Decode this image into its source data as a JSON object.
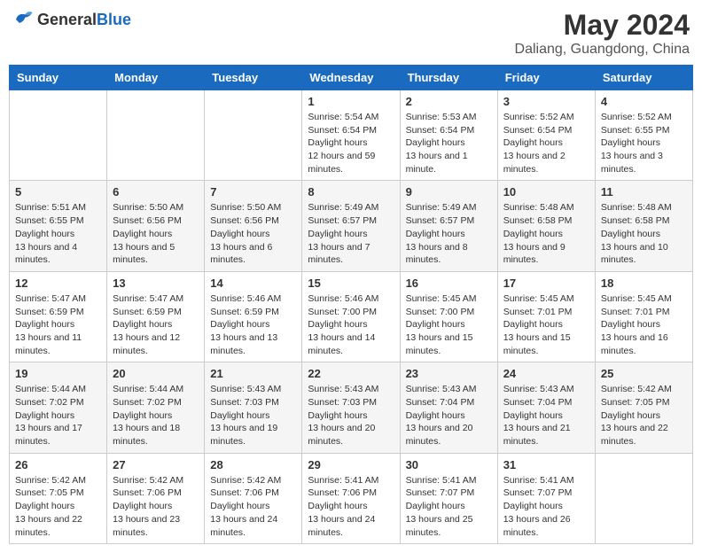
{
  "header": {
    "logo_general": "General",
    "logo_blue": "Blue",
    "month_year": "May 2024",
    "location": "Daliang, Guangdong, China"
  },
  "weekdays": [
    "Sunday",
    "Monday",
    "Tuesday",
    "Wednesday",
    "Thursday",
    "Friday",
    "Saturday"
  ],
  "weeks": [
    [
      null,
      null,
      null,
      {
        "day": 1,
        "sunrise": "5:54 AM",
        "sunset": "6:54 PM",
        "daylight": "12 hours and 59 minutes."
      },
      {
        "day": 2,
        "sunrise": "5:53 AM",
        "sunset": "6:54 PM",
        "daylight": "13 hours and 1 minute."
      },
      {
        "day": 3,
        "sunrise": "5:52 AM",
        "sunset": "6:54 PM",
        "daylight": "13 hours and 2 minutes."
      },
      {
        "day": 4,
        "sunrise": "5:52 AM",
        "sunset": "6:55 PM",
        "daylight": "13 hours and 3 minutes."
      }
    ],
    [
      {
        "day": 5,
        "sunrise": "5:51 AM",
        "sunset": "6:55 PM",
        "daylight": "13 hours and 4 minutes."
      },
      {
        "day": 6,
        "sunrise": "5:50 AM",
        "sunset": "6:56 PM",
        "daylight": "13 hours and 5 minutes."
      },
      {
        "day": 7,
        "sunrise": "5:50 AM",
        "sunset": "6:56 PM",
        "daylight": "13 hours and 6 minutes."
      },
      {
        "day": 8,
        "sunrise": "5:49 AM",
        "sunset": "6:57 PM",
        "daylight": "13 hours and 7 minutes."
      },
      {
        "day": 9,
        "sunrise": "5:49 AM",
        "sunset": "6:57 PM",
        "daylight": "13 hours and 8 minutes."
      },
      {
        "day": 10,
        "sunrise": "5:48 AM",
        "sunset": "6:58 PM",
        "daylight": "13 hours and 9 minutes."
      },
      {
        "day": 11,
        "sunrise": "5:48 AM",
        "sunset": "6:58 PM",
        "daylight": "13 hours and 10 minutes."
      }
    ],
    [
      {
        "day": 12,
        "sunrise": "5:47 AM",
        "sunset": "6:59 PM",
        "daylight": "13 hours and 11 minutes."
      },
      {
        "day": 13,
        "sunrise": "5:47 AM",
        "sunset": "6:59 PM",
        "daylight": "13 hours and 12 minutes."
      },
      {
        "day": 14,
        "sunrise": "5:46 AM",
        "sunset": "6:59 PM",
        "daylight": "13 hours and 13 minutes."
      },
      {
        "day": 15,
        "sunrise": "5:46 AM",
        "sunset": "7:00 PM",
        "daylight": "13 hours and 14 minutes."
      },
      {
        "day": 16,
        "sunrise": "5:45 AM",
        "sunset": "7:00 PM",
        "daylight": "13 hours and 15 minutes."
      },
      {
        "day": 17,
        "sunrise": "5:45 AM",
        "sunset": "7:01 PM",
        "daylight": "13 hours and 15 minutes."
      },
      {
        "day": 18,
        "sunrise": "5:45 AM",
        "sunset": "7:01 PM",
        "daylight": "13 hours and 16 minutes."
      }
    ],
    [
      {
        "day": 19,
        "sunrise": "5:44 AM",
        "sunset": "7:02 PM",
        "daylight": "13 hours and 17 minutes."
      },
      {
        "day": 20,
        "sunrise": "5:44 AM",
        "sunset": "7:02 PM",
        "daylight": "13 hours and 18 minutes."
      },
      {
        "day": 21,
        "sunrise": "5:43 AM",
        "sunset": "7:03 PM",
        "daylight": "13 hours and 19 minutes."
      },
      {
        "day": 22,
        "sunrise": "5:43 AM",
        "sunset": "7:03 PM",
        "daylight": "13 hours and 20 minutes."
      },
      {
        "day": 23,
        "sunrise": "5:43 AM",
        "sunset": "7:04 PM",
        "daylight": "13 hours and 20 minutes."
      },
      {
        "day": 24,
        "sunrise": "5:43 AM",
        "sunset": "7:04 PM",
        "daylight": "13 hours and 21 minutes."
      },
      {
        "day": 25,
        "sunrise": "5:42 AM",
        "sunset": "7:05 PM",
        "daylight": "13 hours and 22 minutes."
      }
    ],
    [
      {
        "day": 26,
        "sunrise": "5:42 AM",
        "sunset": "7:05 PM",
        "daylight": "13 hours and 22 minutes."
      },
      {
        "day": 27,
        "sunrise": "5:42 AM",
        "sunset": "7:06 PM",
        "daylight": "13 hours and 23 minutes."
      },
      {
        "day": 28,
        "sunrise": "5:42 AM",
        "sunset": "7:06 PM",
        "daylight": "13 hours and 24 minutes."
      },
      {
        "day": 29,
        "sunrise": "5:41 AM",
        "sunset": "7:06 PM",
        "daylight": "13 hours and 24 minutes."
      },
      {
        "day": 30,
        "sunrise": "5:41 AM",
        "sunset": "7:07 PM",
        "daylight": "13 hours and 25 minutes."
      },
      {
        "day": 31,
        "sunrise": "5:41 AM",
        "sunset": "7:07 PM",
        "daylight": "13 hours and 26 minutes."
      },
      null
    ]
  ]
}
